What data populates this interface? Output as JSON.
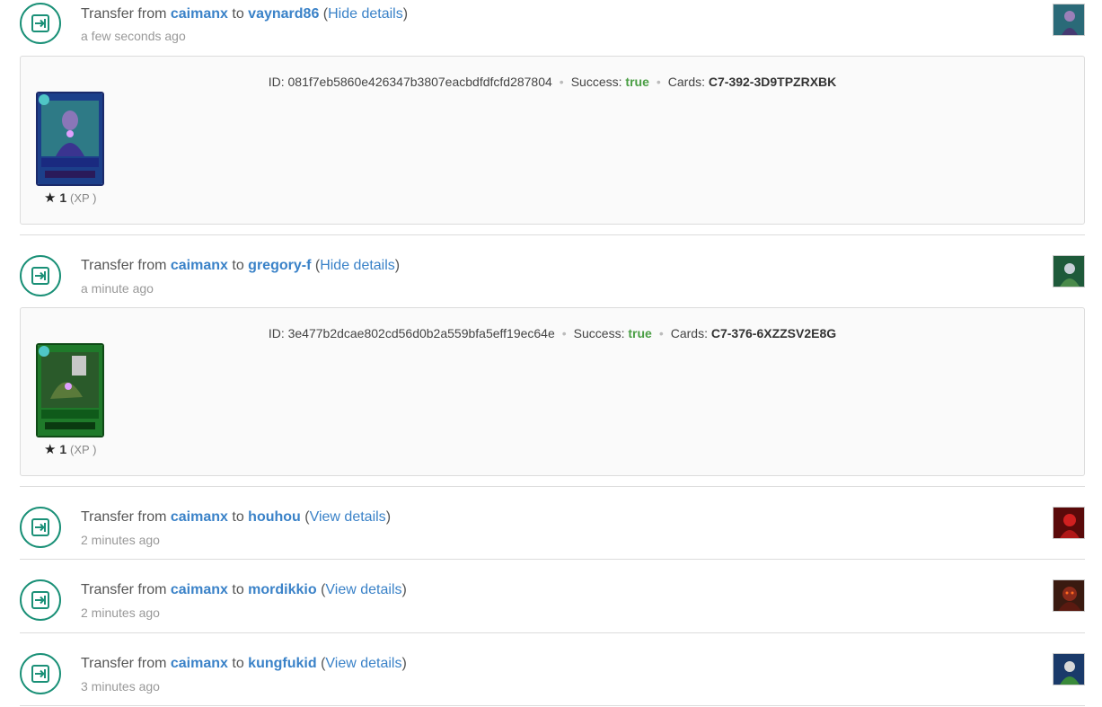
{
  "colors": {
    "accent": "#1a9077",
    "link": "#3a82c8",
    "success": "#4a9e44"
  },
  "events": [
    {
      "from": "caimanx",
      "to": "vaynard86",
      "toggle": "Hide details",
      "time": "a few seconds ago",
      "details": {
        "id": "081f7eb5860e426347b3807eacbdfdfcfd287804",
        "success": "true",
        "cards": "C7-392-3D9TPZRXBK",
        "xp": "1"
      }
    },
    {
      "from": "caimanx",
      "to": "gregory-f",
      "toggle": "Hide details",
      "time": "a minute ago",
      "details": {
        "id": "3e477b2dcae802cd56d0b2a559bfa5eff19ec64e",
        "success": "true",
        "cards": "C7-376-6XZZSV2E8G",
        "xp": "1"
      }
    },
    {
      "from": "caimanx",
      "to": "houhou",
      "toggle": "View details",
      "time": "2 minutes ago"
    },
    {
      "from": "caimanx",
      "to": "mordikkio",
      "toggle": "View details",
      "time": "2 minutes ago"
    },
    {
      "from": "caimanx",
      "to": "kungfukid",
      "toggle": "View details",
      "time": "3 minutes ago"
    }
  ],
  "labels": {
    "transfer_from": "Transfer from",
    "to": "to",
    "open_paren": "(",
    "close_paren": ")",
    "id": "ID:",
    "success": "Success:",
    "cards": "Cards:",
    "xp_label": "(XP )",
    "star_icon": "★"
  }
}
